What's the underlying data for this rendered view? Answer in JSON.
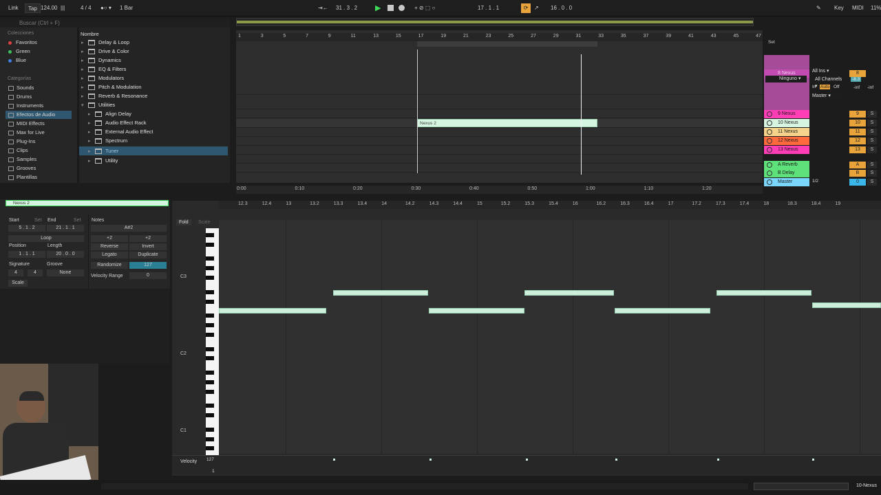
{
  "topbar": {
    "link": "Link",
    "tap": "Tap",
    "tempo": "124.00",
    "signature": "4 / 4",
    "quantize": "1 Bar",
    "position": "31 .  3 .  2",
    "loop_start": "17 .  1 .  1",
    "loop_length": "16 .  0 .  0",
    "key": "Key",
    "midi": "MIDI",
    "cpu": "11%"
  },
  "browser": {
    "search_placeholder": "Buscar (Ctrl + F)",
    "collections_title": "Colecciones",
    "collections": [
      {
        "label": "Favoritos",
        "color": "#e04040"
      },
      {
        "label": "Green",
        "color": "#40c060"
      },
      {
        "label": "Blue",
        "color": "#4080e0"
      }
    ],
    "categories_title": "Categorías",
    "categories": [
      "Sounds",
      "Drums",
      "Instruments",
      "Efectos de Audio",
      "MIDI Effects",
      "Max for Live",
      "Plug-Ins",
      "Clips",
      "Samples",
      "Grooves",
      "Plantillas"
    ],
    "name_header": "Nombre",
    "tree": [
      "Delay & Loop",
      "Drive & Color",
      "Dynamics",
      "EQ & Filters",
      "Modulators",
      "Pitch & Modulation",
      "Reverb & Resonance",
      "Utilities",
      "Align Delay",
      "Audio Effect Rack",
      "External Audio Effect",
      "Spectrum",
      "Tuner",
      "Utility"
    ]
  },
  "arrangement": {
    "ruler": [
      "1",
      "3",
      "5",
      "7",
      "9",
      "11",
      "13",
      "15",
      "17",
      "19",
      "21",
      "23",
      "25",
      "27",
      "29",
      "31",
      "33",
      "35",
      "37",
      "39",
      "41",
      "43",
      "45",
      "47"
    ],
    "time_ruler": [
      "0:00",
      "0:10",
      "0:20",
      "0:30",
      "0:40",
      "0:50",
      "1:00",
      "1:10",
      "1:20"
    ],
    "clip_name": "Nexus 2",
    "set_label": "Set"
  },
  "mixer": {
    "tracks": [
      {
        "name": "8 Nexus",
        "color": "#c24ab0",
        "num": "8"
      },
      {
        "name": "9 Nexus",
        "color": "#ff3db5",
        "num": "9"
      },
      {
        "name": "10 Nexus",
        "color": "#d6f5e0",
        "num": "10"
      },
      {
        "name": "11 Nexus",
        "color": "#f5d38a",
        "num": "11"
      },
      {
        "name": "12 Nexus",
        "color": "#ff6a3d",
        "num": "12"
      },
      {
        "name": "13 Nexus",
        "color": "#ff3db5",
        "num": "13"
      },
      {
        "name": "A Reverb",
        "color": "#5ee07a",
        "num": "A"
      },
      {
        "name": "B Delay",
        "color": "#5ee07a",
        "num": "B"
      },
      {
        "name": "Master",
        "color": "#7ad6ff",
        "num": "0"
      }
    ],
    "input_type": "All Ins",
    "input_channel": "All Channels",
    "monitor_in": "In",
    "monitor_auto": "Auto",
    "monitor_off": "Off",
    "output": "Master",
    "device_none": "Ninguno",
    "volume": "-8.3",
    "inf1": "-inf",
    "inf2": "-inf",
    "master_fraction": "1/2"
  },
  "clip": {
    "title": "Nexus 2",
    "start_label": "Start",
    "end_label": "End",
    "set": "Set",
    "start_value": "5 .  1 .  2",
    "end_value": "21 .  1 .  1",
    "loop": "Loop",
    "position_label": "Position",
    "length_label": "Length",
    "position_value": "1 .  1 .  1",
    "length_value": "20 .  0 .  0",
    "signature_label": "Signature",
    "groove_label": "Groove",
    "sig_num": "4",
    "sig_den": "4",
    "groove_value": "None",
    "scale": "Scale",
    "notes_label": "Notes",
    "note_name": "A#2",
    "plus1": "+2",
    "plus2": "+2",
    "reverse": "Reverse",
    "invert": "Invert",
    "legato": "Legato",
    "duplicate": "Duplicate",
    "randomize": "Randomize",
    "randomize_value": "127",
    "velocity_range": "Velocity Range",
    "velocity_range_value": "0"
  },
  "piano_roll": {
    "fold": "Fold",
    "scale": "Scale",
    "ruler": [
      "12.3",
      "12.4",
      "13",
      "13.2",
      "13.3",
      "13.4",
      "14",
      "14.2",
      "14.3",
      "14.4",
      "15",
      "15.2",
      "15.3",
      "15.4",
      "16",
      "16.2",
      "16.3",
      "16.4",
      "17",
      "17.2",
      "17.3",
      "17.4",
      "18",
      "18.3",
      "18.4",
      "19"
    ],
    "octaves": [
      "C3",
      "C2",
      "C1"
    ],
    "velocity_label": "Velocity",
    "velocity_max": "127",
    "velocity_min": "1"
  },
  "status": {
    "track": "10-Nexus"
  }
}
